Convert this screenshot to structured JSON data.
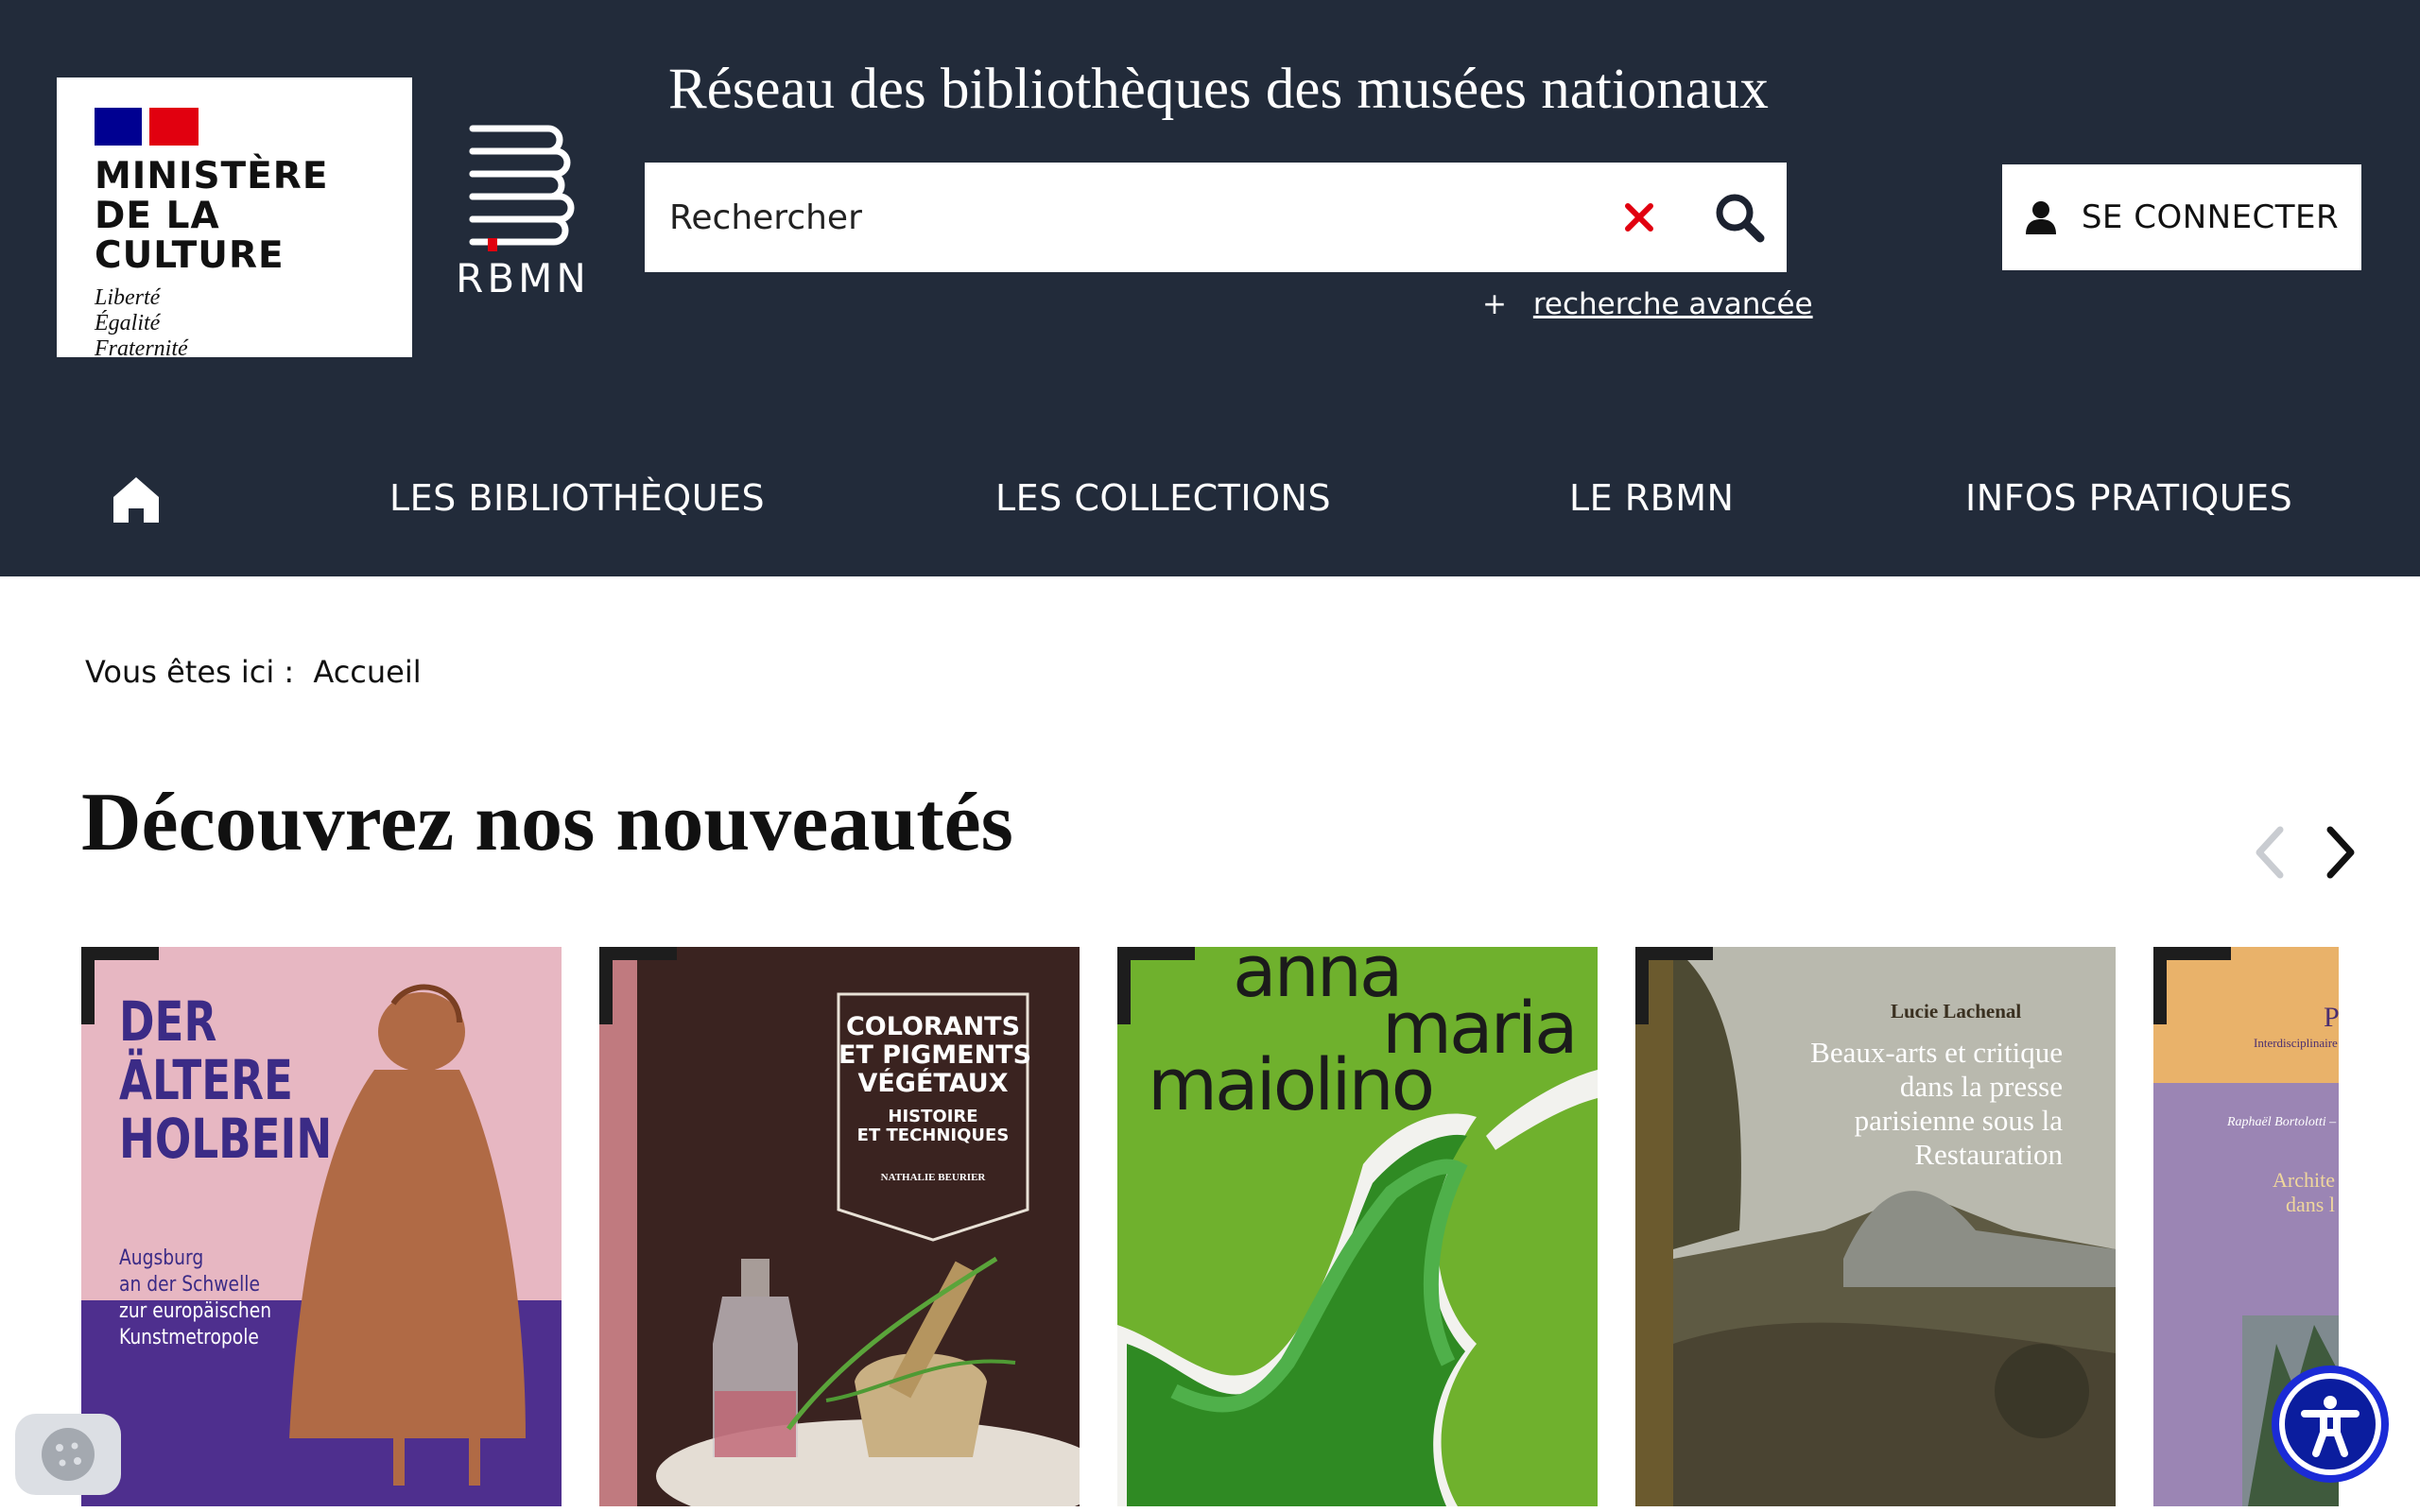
{
  "header": {
    "ministere": {
      "title_line1": "MINISTÈRE",
      "title_line2": "DE LA CULTURE",
      "motto": [
        "Liberté",
        "Égalité",
        "Fraternité"
      ]
    },
    "rbmn_logo_text": "RBMN",
    "site_title": "Réseau des bibliothèques des musées nationaux",
    "search": {
      "placeholder": "Rechercher",
      "clear_icon": "close-icon",
      "submit_icon": "search-icon"
    },
    "advanced_search": {
      "prefix": "+",
      "label": "recherche avancée"
    },
    "login": {
      "icon": "user-icon",
      "label": "SE CONNECTER"
    }
  },
  "nav": {
    "home_icon": "home-icon",
    "items": [
      {
        "label": "LES BIBLIOTHÈQUES"
      },
      {
        "label": "LES COLLECTIONS"
      },
      {
        "label": "LE RBMN"
      },
      {
        "label": "INFOS PRATIQUES"
      }
    ]
  },
  "breadcrumb": {
    "prefix": "Vous êtes ici :",
    "current": "Accueil"
  },
  "section": {
    "title": "Découvrez nos nouveautés",
    "prev_icon": "chevron-left-icon",
    "next_icon": "chevron-right-icon"
  },
  "books": [
    {
      "title_lines": [
        "DER",
        "ÄLTERE",
        "HOLBEIN"
      ],
      "subtitle_lines": [
        "Augsburg",
        "an der Schwelle",
        "zur europäischen",
        "Kunstmetropole"
      ]
    },
    {
      "title_lines": [
        "COLORANTS",
        "ET PIGMENTS",
        "VÉGÉTAUX"
      ],
      "sub_lines": [
        "HISTOIRE",
        "ET TECHNIQUES"
      ],
      "author": "NATHALIE BEURIER"
    },
    {
      "title_lines": [
        "anna",
        "maria",
        "maiolino"
      ]
    },
    {
      "author": "Lucie Lachenal",
      "title_lines": [
        "Beaux-arts et critique",
        "dans la presse",
        "parisienne sous la",
        "Restauration"
      ]
    },
    {
      "t1": "P",
      "t2": "Interdisciplinaire",
      "t3": "Raphaël Bortolotti –",
      "t4_lines": [
        "Archite",
        "dans l"
      ]
    }
  ],
  "floating": {
    "cookie_icon": "cookie-icon",
    "accessibility_icon": "accessibility-icon"
  },
  "colors": {
    "header_bg": "#222b3a",
    "marianne_blue": "#000091",
    "marianne_red": "#e1000f",
    "clear_red": "#e1000f"
  }
}
